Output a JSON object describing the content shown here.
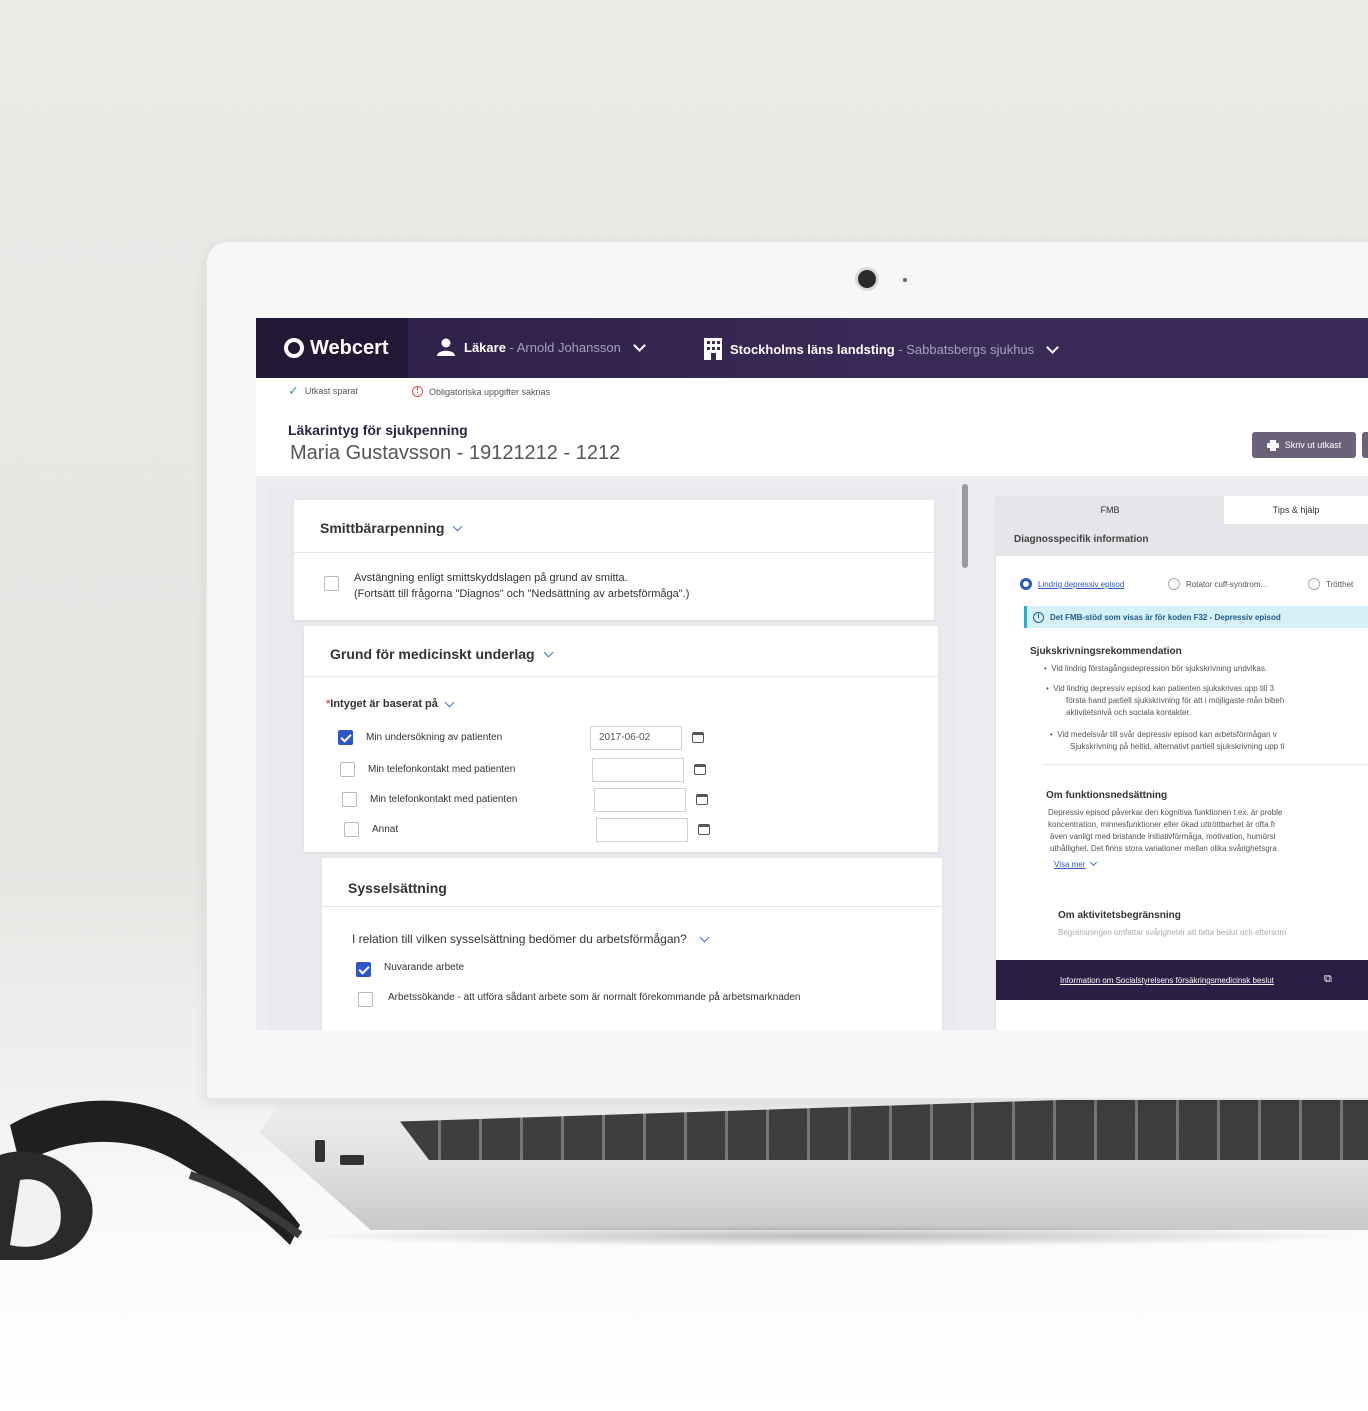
{
  "app": {
    "logo": "Webcert",
    "user_role": "Läkare",
    "user_name": " - Arnold Johansson",
    "unit_name": "Stockholms läns landsting",
    "unit_sub": " - Sabbatsbergs sjukhus",
    "accent_color": "#2c1f45"
  },
  "status": {
    "saved": "Utkast sparat",
    "missing": "Obligatoriska uppgifter saknas"
  },
  "header": {
    "form_type": "Läkarintyg för sjukpenning",
    "patient": "Maria Gustavsson - 19121212 - 1212",
    "print_label": "Skriv ut utkast"
  },
  "form": {
    "smitta": {
      "title": "Smittbärarpenning",
      "checkbox_label": "Avstängning enligt smittskyddslagen på grund av smitta.",
      "checkbox_sub": "(Fortsätt till frågorna \"Diagnos\" och \"Nedsättning av arbetsförmåga\".)",
      "checked": false
    },
    "grund": {
      "title": "Grund för medicinskt underlag",
      "question": "Intyget är baserat på",
      "required_mark": "*",
      "items": [
        {
          "label": "Min undersökning av patienten",
          "checked": true,
          "date": "2017-06-02"
        },
        {
          "label": "Min telefonkontakt med patienten",
          "checked": false,
          "date": ""
        },
        {
          "label": "Min telefonkontakt med patienten",
          "checked": false,
          "date": ""
        },
        {
          "label": "Annat",
          "checked": false,
          "date": ""
        }
      ]
    },
    "syssel": {
      "title": "Sysselsättning",
      "question": "I relation till vilken sysselsättning bedömer du arbetsförmågan?",
      "items": [
        {
          "label": "Nuvarande arbete",
          "checked": true
        },
        {
          "label": "Arbetssökande - att utföra sådant arbete som är normalt förekommande på arbetsmarknaden",
          "checked": false
        }
      ]
    }
  },
  "side": {
    "tabs": [
      "FMB",
      "Tips & hjälp"
    ],
    "subtitle": "Diagnosspecifik information",
    "diagnoses": [
      {
        "label": "Lindrig depressiv episod",
        "selected": true
      },
      {
        "label": "Rotator cuff-syndrom...",
        "selected": false
      },
      {
        "label": "Trötthet",
        "selected": false
      }
    ],
    "info": "Det FMB-stöd som visas är för koden F32 - Depressiv episod",
    "recommendation_title": "Sjukskrivningsrekommendation",
    "bullets": [
      "Vid lindrig förstagångsdepression bör sjukskrivning undvikas.",
      "Vid lindrig depressiv episod kan patienten sjukskrivas upp till 3",
      "första hand partiell sjukskrivning för att i möjligaste mån bibeh",
      "aktivitetsnivå och sociala kontakter.",
      "Vid medelsvår till svår depressiv episod kan arbetsförmågan v",
      "Sjukskrivning på heltid, alternativt partiell sjukskrivning upp ti"
    ],
    "funktion_title": "Om funktionsnedsättning",
    "funktion_lines": [
      "Depressiv episod påverkar den kognitiva funktionen t.ex. är proble",
      "koncentration, minnesfunktioner eller ökad uttröttbarhet är ofta fr",
      "även vanligt med bristande initiativförmåga, motivation, humörsl",
      "uthållighet. Det finns stora variationer mellan olika svårighetsgra"
    ],
    "show_more": "Visa mer",
    "aktivitet_title": "Om aktivitetsbegränsning",
    "aktivitet_line": "Begränsningen omfattar svårigheter att fatta beslut och eftersom",
    "footer_link": "Information om Socialstyrelsens försäkringsmedicinsk beslut"
  }
}
